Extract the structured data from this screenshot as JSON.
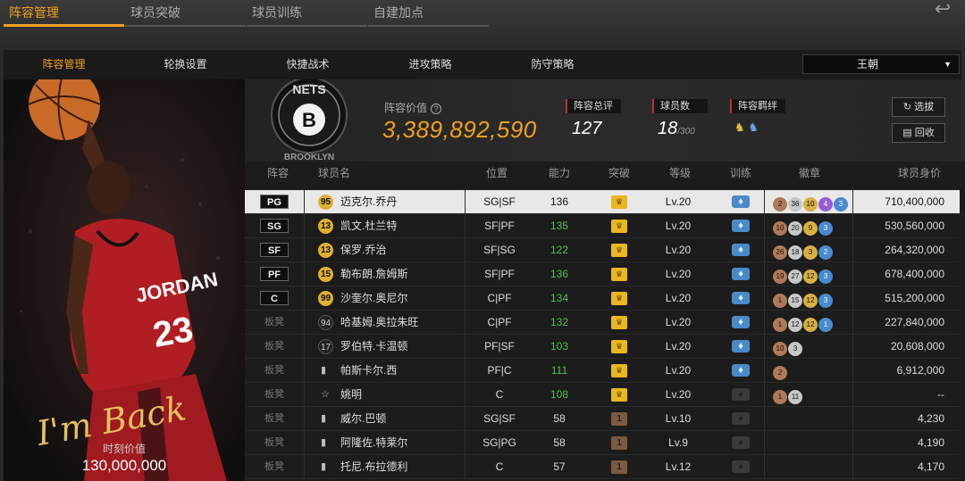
{
  "top_tabs": [
    {
      "label": "阵容管理",
      "active": true
    },
    {
      "label": "球员突破",
      "active": false
    },
    {
      "label": "球员训练",
      "active": false
    },
    {
      "label": "自建加点",
      "active": false
    }
  ],
  "sub_tabs": [
    {
      "label": "阵容管理",
      "active": true
    },
    {
      "label": "轮换设置",
      "active": false
    },
    {
      "label": "快捷战术",
      "active": false
    },
    {
      "label": "进攻策略",
      "active": false
    },
    {
      "label": "防守策略",
      "active": false
    }
  ],
  "team_select": {
    "value": "王朝"
  },
  "featured": {
    "signature": "I'm Back",
    "jersey_name": "JORDAN",
    "jersey_number": "23",
    "value_label": "时刻价值",
    "value": "130,000,000"
  },
  "team": {
    "logo_text": "NETS",
    "logo_letter": "B",
    "logo_bottom": "BROOKLYN",
    "value_label": "阵容价值",
    "value": "3,389,892,590",
    "rating_label": "阵容总评",
    "rating": "127",
    "players_label": "球员数",
    "players": "18",
    "players_max": "/300",
    "bond_label": "阵容羁绊"
  },
  "buttons": {
    "select": "选拔",
    "recycle": "回收"
  },
  "columns": [
    "阵容",
    "球员名",
    "位置",
    "能力",
    "突破",
    "等级",
    "训练",
    "徽章",
    "球员身价"
  ],
  "rows": [
    {
      "slot": "PG",
      "starter": true,
      "selected": true,
      "card": "95",
      "card_style": "gold",
      "name": "迈克尔.乔丹",
      "pos": "SG|SF",
      "rating": "136",
      "green": false,
      "break": "crown",
      "level": "Lv.20",
      "train": true,
      "badges": [
        [
          "2",
          "bronze"
        ],
        [
          "36",
          "silver"
        ],
        [
          "10",
          "gold"
        ],
        [
          "4",
          "purple"
        ],
        [
          "3",
          "blue"
        ]
      ],
      "salary": "710,400,000"
    },
    {
      "slot": "SG",
      "starter": true,
      "selected": false,
      "card": "13",
      "card_style": "gold",
      "name": "凯文.杜兰特",
      "pos": "SF|PF",
      "rating": "135",
      "green": true,
      "break": "crown",
      "level": "Lv.20",
      "train": true,
      "badges": [
        [
          "10",
          "bronze"
        ],
        [
          "20",
          "silver"
        ],
        [
          "9",
          "gold"
        ],
        [
          "3",
          "blue"
        ]
      ],
      "salary": "530,560,000"
    },
    {
      "slot": "SF",
      "starter": true,
      "selected": false,
      "card": "13",
      "card_style": "gold",
      "name": "保罗.乔治",
      "pos": "SF|SG",
      "rating": "122",
      "green": true,
      "break": "crown",
      "level": "Lv.20",
      "train": true,
      "badges": [
        [
          "26",
          "bronze"
        ],
        [
          "18",
          "silver"
        ],
        [
          "3",
          "gold"
        ],
        [
          "2",
          "blue"
        ]
      ],
      "salary": "264,320,000"
    },
    {
      "slot": "PF",
      "starter": true,
      "selected": false,
      "card": "15",
      "card_style": "gold",
      "name": "勒布朗.詹姆斯",
      "pos": "SF|PF",
      "rating": "136",
      "green": true,
      "break": "crown",
      "level": "Lv.20",
      "train": true,
      "badges": [
        [
          "19",
          "bronze"
        ],
        [
          "27",
          "silver"
        ],
        [
          "12",
          "gold"
        ],
        [
          "3",
          "blue"
        ]
      ],
      "salary": "678,400,000"
    },
    {
      "slot": "C",
      "starter": true,
      "selected": false,
      "card": "99",
      "card_style": "gold",
      "name": "沙奎尔.奥尼尔",
      "pos": "C|PF",
      "rating": "134",
      "green": true,
      "break": "crown",
      "level": "Lv.20",
      "train": true,
      "badges": [
        [
          "1",
          "bronze"
        ],
        [
          "15",
          "silver"
        ],
        [
          "12",
          "gold"
        ],
        [
          "3",
          "blue"
        ]
      ],
      "salary": "515,200,000"
    },
    {
      "slot": "板凳",
      "starter": false,
      "selected": false,
      "card": "94",
      "card_style": "plain",
      "name": "哈基姆.奥拉朱旺",
      "pos": "C|PF",
      "rating": "132",
      "green": true,
      "break": "crown",
      "level": "Lv.20",
      "train": true,
      "badges": [
        [
          "1",
          "bronze"
        ],
        [
          "12",
          "silver"
        ],
        [
          "12",
          "gold"
        ],
        [
          "1",
          "blue"
        ]
      ],
      "salary": "227,840,000"
    },
    {
      "slot": "板凳",
      "starter": false,
      "selected": false,
      "card": "17",
      "card_style": "plain",
      "name": "罗伯特.卡温顿",
      "pos": "PF|SF",
      "rating": "103",
      "green": true,
      "break": "crown",
      "level": "Lv.20",
      "train": true,
      "badges": [
        [
          "10",
          "bronze"
        ],
        [
          "3",
          "silver"
        ]
      ],
      "salary": "20,608,000"
    },
    {
      "slot": "板凳",
      "starter": false,
      "selected": false,
      "card": "",
      "card_style": "bars",
      "name": "帕斯卡尔.西",
      "pos": "PF|C",
      "rating": "111",
      "green": true,
      "break": "crown",
      "level": "Lv.20",
      "train": true,
      "badges": [
        [
          "2",
          "bronze"
        ]
      ],
      "salary": "6,912,000"
    },
    {
      "slot": "板凳",
      "starter": false,
      "selected": false,
      "card": "",
      "card_style": "star",
      "name": "姚明",
      "pos": "C",
      "rating": "108",
      "green": true,
      "break": "crown",
      "level": "Lv.20",
      "train": false,
      "badges": [
        [
          "1",
          "bronze"
        ],
        [
          "11",
          "silver"
        ]
      ],
      "salary": "--"
    },
    {
      "slot": "板凳",
      "starter": false,
      "selected": false,
      "card": "",
      "card_style": "bars",
      "name": "威尔.巴顿",
      "pos": "SG|SF",
      "rating": "58",
      "green": false,
      "break": "1",
      "level": "Lv.10",
      "train": false,
      "badges": [],
      "salary": "4,230"
    },
    {
      "slot": "板凳",
      "starter": false,
      "selected": false,
      "card": "",
      "card_style": "bars",
      "name": "阿隆佐.特莱尔",
      "pos": "SG|PG",
      "rating": "58",
      "green": false,
      "break": "1",
      "level": "Lv.9",
      "train": false,
      "badges": [],
      "salary": "4,190"
    },
    {
      "slot": "板凳",
      "starter": false,
      "selected": false,
      "card": "",
      "card_style": "bars",
      "name": "托尼.布拉德利",
      "pos": "C",
      "rating": "57",
      "green": false,
      "break": "1",
      "level": "Lv.12",
      "train": false,
      "badges": [],
      "salary": "4,170"
    }
  ]
}
